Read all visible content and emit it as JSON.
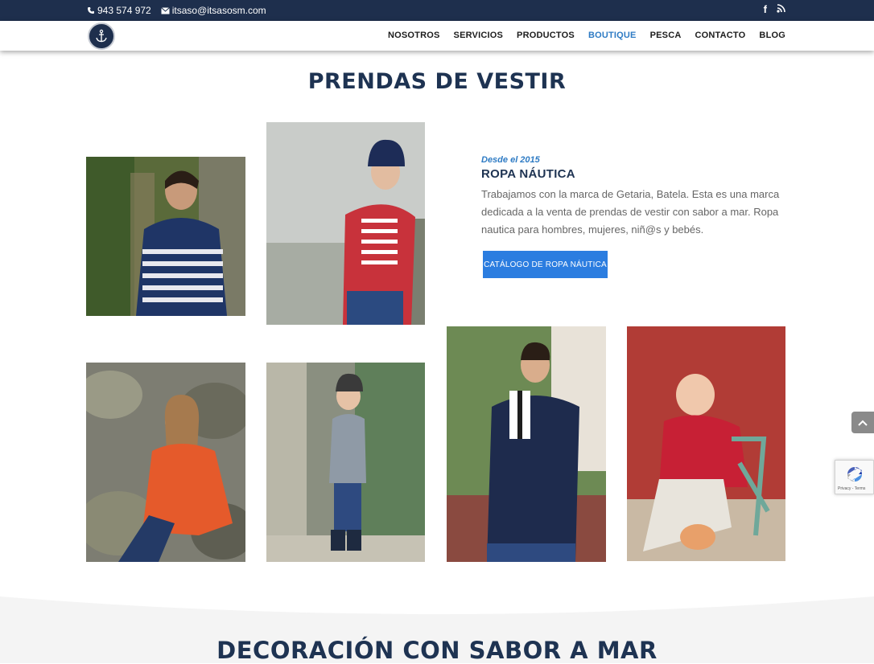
{
  "topbar": {
    "phone": "943 574 972",
    "email": "itsaso@itsasosm.com",
    "social": [
      "facebook-icon",
      "rss-icon"
    ]
  },
  "nav": {
    "items": [
      "NOSOTROS",
      "SERVICIOS",
      "PRODUCTOS",
      "BOUTIQUE",
      "PESCA",
      "CONTACTO",
      "BLOG"
    ],
    "active": "BOUTIQUE"
  },
  "section1": {
    "title": "PRENDAS DE VESTIR",
    "kicker": "Desde el 2015",
    "heading": "ROPA NÁUTICA",
    "description": "Trabajamos con la marca de Getaria, Batela. Esta es una marca dedicada a la venta de prendas de vestir con sabor a mar. Ropa nautica para hombres, mujeres, niñ@s y bebés.",
    "button": "CATÁLOGO DE ROPA NÁUTICA"
  },
  "section2": {
    "title": "DECORACIÓN CON SABOR A MAR"
  },
  "recaptcha": {
    "links": "Privacy - Terms"
  },
  "colors": {
    "navy": "#1e2f4d",
    "accent_blue": "#2e7bc4",
    "button_blue": "#2b7de0"
  }
}
